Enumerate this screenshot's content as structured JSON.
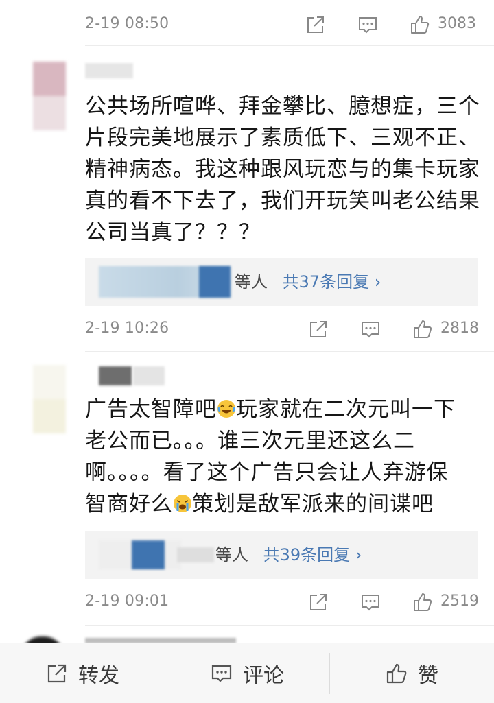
{
  "comments": [
    {
      "time": "2-19 08:50",
      "like_count": "3083"
    },
    {
      "text_lines": [
        "公共场所喧哗、拜金攀比、臆想症，三个",
        "片段完美地展示了素质低下、三观不正、",
        "精神病态。我这种跟风玩恋与的集卡玩家",
        "真的看不下去了，我们开玩笑叫老公结果",
        "公司当真了？？？"
      ],
      "reply_tail": "等人",
      "reply_link": "共37条回复 ›",
      "time": "2-19 10:26",
      "like_count": "2818"
    },
    {
      "text_lines": [
        "广告太智障吧",
        "玩家就在二次元叫一下",
        "老公而已。。。谁三次元里还这么二",
        "啊。。。。看了这个广告只会让人弃游保",
        "智商好么",
        "策划是敌军派来的间谍吧"
      ],
      "emoji": [
        "laughing-tears-emoji",
        "crying-emoji"
      ],
      "reply_tail": "等人",
      "reply_link": "共39条回复 ›",
      "time": "2-19 09:01",
      "like_count": "2519"
    }
  ],
  "bottom_bar": {
    "forward_label": "转发",
    "comment_label": "评论",
    "like_label": "赞"
  },
  "colors": {
    "meta_gray": "#8a8a8a",
    "link_blue": "#4a79b3",
    "reply_bg": "#f3f3f3"
  }
}
